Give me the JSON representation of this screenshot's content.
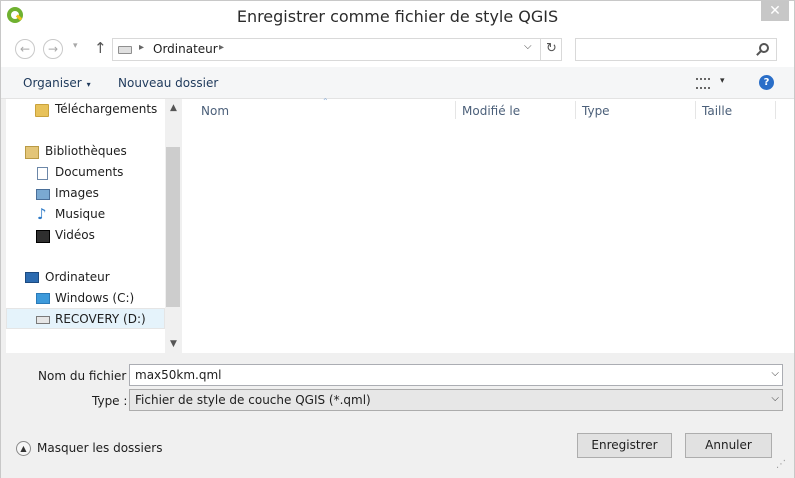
{
  "window": {
    "title": "Enregistrer comme fichier de style QGIS",
    "close_glyph": "✕"
  },
  "navbar": {
    "back_glyph": "←",
    "forward_glyph": "→",
    "recent_glyph": "▾",
    "up_glyph": "↑",
    "address": "Ordinateur",
    "addr_sep_glyph": "▸",
    "addr_dd_glyph": "⌵",
    "refresh_glyph": "↻",
    "search_placeholder": ""
  },
  "cmdbar": {
    "organize": "Organiser",
    "new_folder": "Nouveau dossier",
    "caret_glyph": "▾",
    "help_glyph": "?"
  },
  "sidebar": {
    "items": [
      {
        "label": "Téléchargements",
        "icon": "folder-icon"
      },
      {
        "label": "Bibliothèques",
        "icon": "library-icon"
      },
      {
        "label": "Documents",
        "icon": "document-icon"
      },
      {
        "label": "Images",
        "icon": "image-icon"
      },
      {
        "label": "Musique",
        "icon": "music-icon"
      },
      {
        "label": "Vidéos",
        "icon": "video-icon"
      },
      {
        "label": "Ordinateur",
        "icon": "computer-icon"
      },
      {
        "label": "Windows (C:)",
        "icon": "windows-drive-icon"
      },
      {
        "label": "RECOVERY (D:)",
        "icon": "drive-icon"
      }
    ],
    "music_glyph": "♪",
    "scroll_up_glyph": "▲",
    "scroll_down_glyph": "▼"
  },
  "file_list": {
    "columns": [
      "Nom",
      "Modifié le",
      "Type",
      "Taille"
    ],
    "sort_glyph": "⌃"
  },
  "form": {
    "filename_label": "Nom du fichier :",
    "filename_value": "max50km.qml",
    "type_label": "Type :",
    "type_value": "Fichier de style de couche QGIS (*.qml)",
    "dd_glyph": "⌵"
  },
  "footer": {
    "hide_folders": "Masquer les dossiers",
    "hide_glyph": "▲",
    "save": "Enregistrer",
    "cancel": "Annuler",
    "grip_glyph": "⋰"
  },
  "colors": {
    "accent": "#2a6ec8",
    "qgis_green": "#6fb130",
    "selection": "#e5f3fb"
  }
}
